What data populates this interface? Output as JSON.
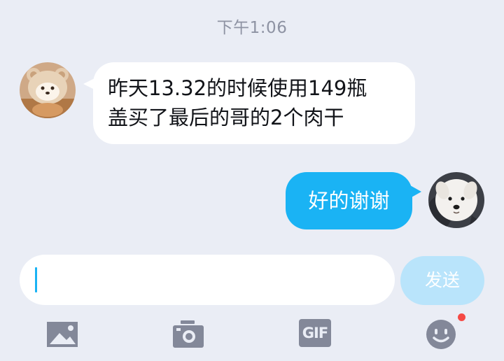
{
  "chat": {
    "timestamp": "下午1:06",
    "messages": [
      {
        "direction": "incoming",
        "text": "昨天13.32的时候使用149瓶\n盖买了最后的哥的2个肉干",
        "avatar": "bear-hat-cat-avatar"
      },
      {
        "direction": "outgoing",
        "text": "好的谢谢",
        "avatar": "white-puppy-avatar"
      }
    ]
  },
  "composer": {
    "input_value": "",
    "send_label": "发送"
  },
  "toolbar": {
    "items": [
      {
        "icon": "image-icon"
      },
      {
        "icon": "camera-icon"
      },
      {
        "icon": "gif-icon",
        "label": "GIF"
      },
      {
        "icon": "emoji-icon",
        "has_notification_dot": true
      }
    ]
  },
  "colors": {
    "background": "#eaedf5",
    "accent": "#1ab3f4",
    "send_disabled": "#b9e4fb",
    "icon": "#838899",
    "notification": "#f54a45"
  }
}
